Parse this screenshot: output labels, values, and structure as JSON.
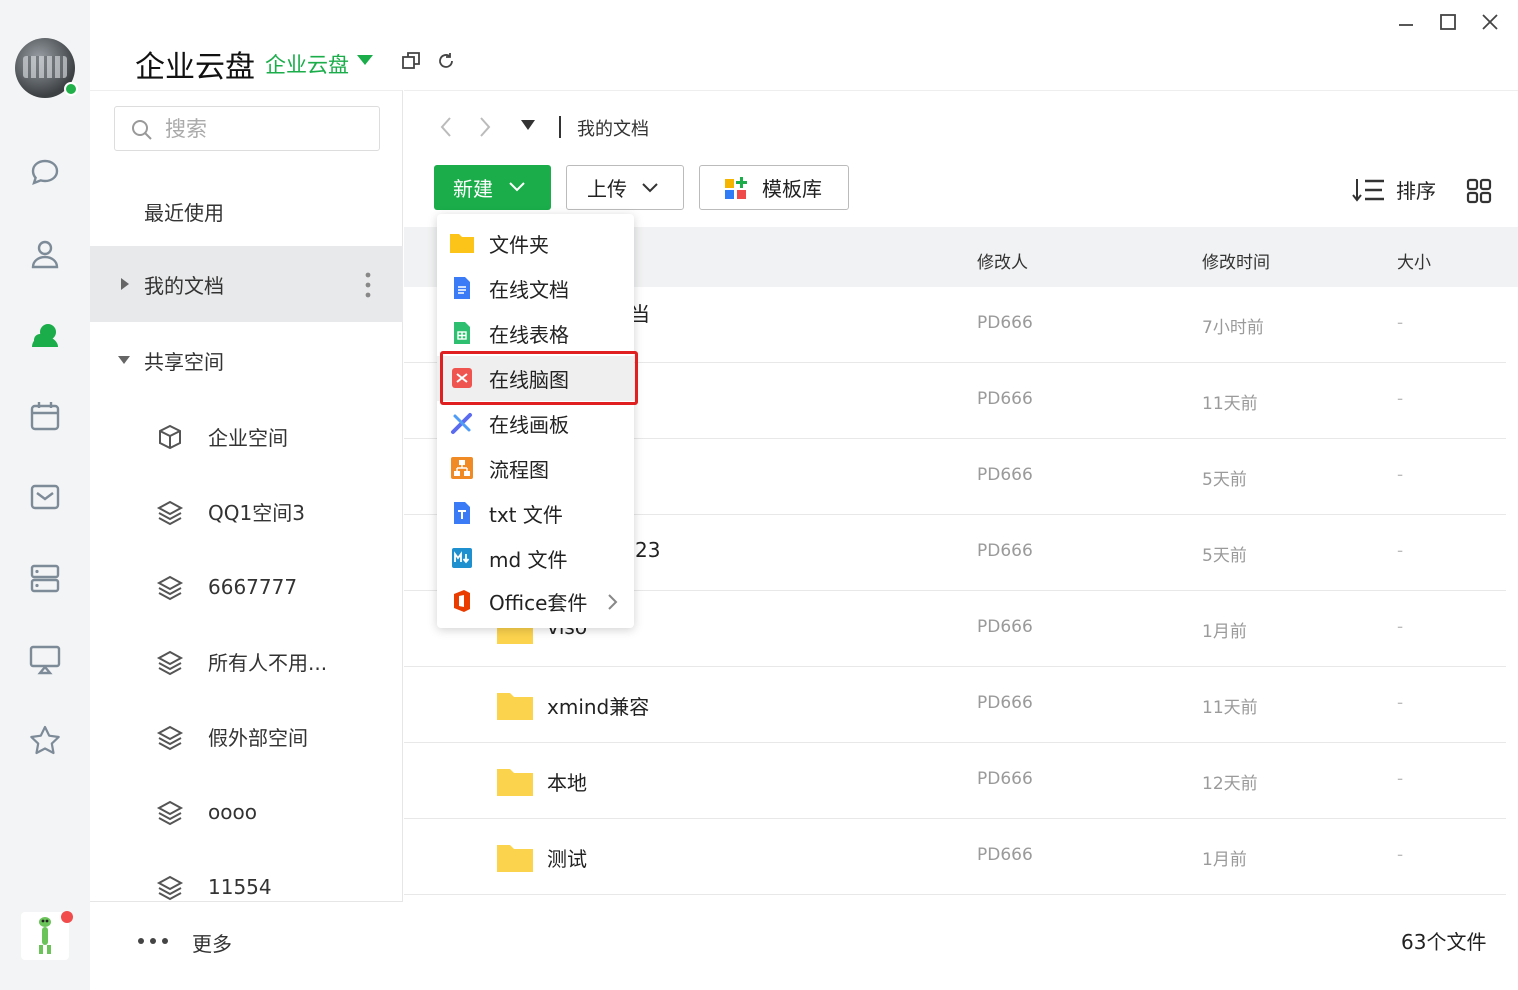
{
  "app": {
    "title": "企业云盘",
    "switcher_label": "企业云盘"
  },
  "sidebar": {
    "search_placeholder": "搜索",
    "recent": "最近使用",
    "my_docs": "我的文档",
    "shared": "共享空间",
    "spaces": [
      {
        "label": "企业空间",
        "icon": "cube-icon"
      },
      {
        "label": "QQ1空间3",
        "icon": "layers-icon"
      },
      {
        "label": "6667777",
        "icon": "layers-icon"
      },
      {
        "label": "所有人不用...",
        "icon": "layers-icon"
      },
      {
        "label": "假外部空间",
        "icon": "layers-icon"
      },
      {
        "label": "oooo",
        "icon": "layers-icon"
      },
      {
        "label": "11554",
        "icon": "layers-icon"
      }
    ],
    "more": "更多"
  },
  "breadcrumb": {
    "current": "我的文档"
  },
  "toolbar": {
    "new_label": "新建",
    "upload_label": "上传",
    "template_label": "模板库",
    "sort_label": "排序"
  },
  "table": {
    "headers": {
      "modifier": "修改人",
      "modified_time": "修改时间",
      "size": "大小"
    },
    "rows": [
      {
        "name": "当",
        "modifier": "PD666",
        "time": "7小时前",
        "size": "-"
      },
      {
        "name": "",
        "modifier": "PD666",
        "time": "11天前",
        "size": "-"
      },
      {
        "name": "",
        "modifier": "PD666",
        "time": "5天前",
        "size": "-"
      },
      {
        "name": "23",
        "modifier": "PD666",
        "time": "5天前",
        "size": "-"
      },
      {
        "name": "viso",
        "modifier": "PD666",
        "time": "1月前",
        "size": "-"
      },
      {
        "name": "xmind兼容",
        "modifier": "PD666",
        "time": "11天前",
        "size": "-"
      },
      {
        "name": "本地",
        "modifier": "PD666",
        "time": "12天前",
        "size": "-"
      },
      {
        "name": "测试",
        "modifier": "PD666",
        "time": "1月前",
        "size": "-"
      }
    ],
    "file_count": "63个文件"
  },
  "new_menu": {
    "items": [
      {
        "label": "文件夹",
        "icon": "folder-icon"
      },
      {
        "label": "在线文档",
        "icon": "online-doc-icon"
      },
      {
        "label": "在线表格",
        "icon": "online-sheet-icon"
      },
      {
        "label": "在线脑图",
        "icon": "mindmap-icon"
      },
      {
        "label": "在线画板",
        "icon": "whiteboard-icon"
      },
      {
        "label": "流程图",
        "icon": "flowchart-icon"
      },
      {
        "label": "txt 文件",
        "icon": "txt-file-icon"
      },
      {
        "label": "md 文件",
        "icon": "md-file-icon"
      },
      {
        "label": "Office套件",
        "icon": "office-icon"
      }
    ]
  },
  "colors": {
    "brand_green": "#1aad4a",
    "highlight_red": "#e02020",
    "folder_yellow": "#fcd34d"
  }
}
